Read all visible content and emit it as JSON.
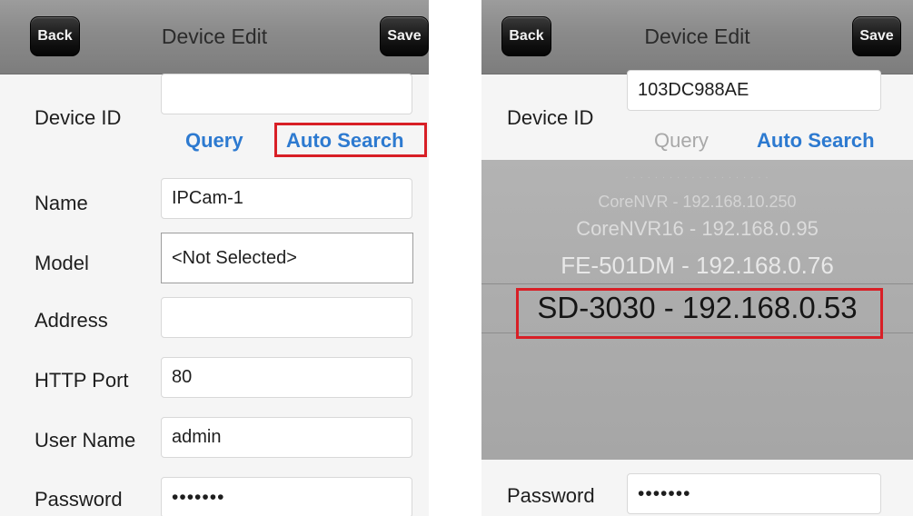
{
  "left_screen": {
    "nav": {
      "back_label": "Back",
      "title": "Device Edit",
      "save_label": "Save"
    },
    "device_id": {
      "label": "Device ID",
      "value": ""
    },
    "query_label": "Query",
    "auto_search_label": "Auto Search",
    "name": {
      "label": "Name",
      "value": "IPCam-1"
    },
    "model": {
      "label": "Model",
      "value": "<Not Selected>"
    },
    "address": {
      "label": "Address",
      "value": ""
    },
    "http_port": {
      "label": "HTTP Port",
      "value": "80"
    },
    "user_name": {
      "label": "User Name",
      "value": "admin"
    },
    "password": {
      "label": "Password",
      "value": "•••••••"
    }
  },
  "right_screen": {
    "nav": {
      "back_label": "Back",
      "title": "Device Edit",
      "save_label": "Save"
    },
    "device_id": {
      "label": "Device ID",
      "value": "103DC988AE"
    },
    "query_label": "Query",
    "auto_search_label": "Auto Search",
    "picker": {
      "items": [
        "CoreNVR - 192.168.10.250",
        "CoreNVR16 - 192.168.0.95",
        "FE-501DM - 192.168.0.76",
        "SD-3030 - 192.168.0.53"
      ],
      "selected_index": 3
    },
    "password": {
      "label": "Password",
      "value": "•••••••"
    }
  },
  "colors": {
    "link_blue": "#2d7ad0",
    "highlight_red": "#d81f26",
    "nav_bar": "#8a8a8a",
    "picker_bg": "#acacac"
  }
}
